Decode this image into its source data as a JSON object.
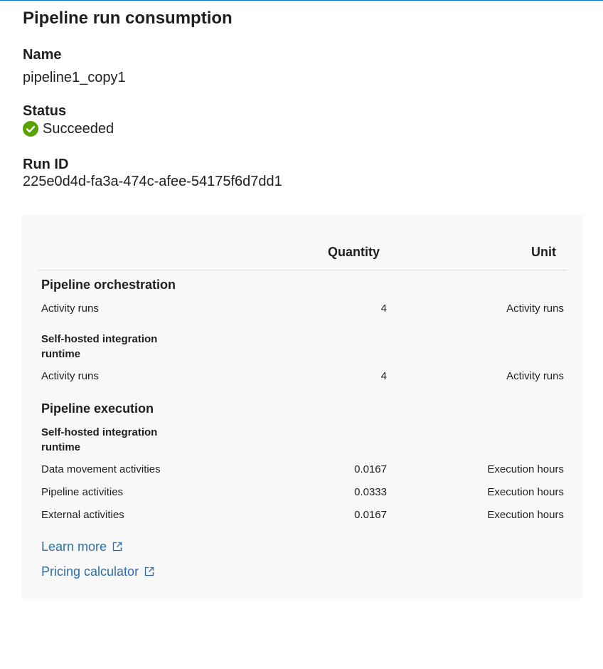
{
  "panel": {
    "title": "Pipeline run consumption"
  },
  "details": {
    "name_label": "Name",
    "name_value": "pipeline1_copy1",
    "status_label": "Status",
    "status_value": "Succeeded",
    "run_id_label": "Run ID",
    "run_id_value": "225e0d4d-fa3a-474c-afee-54175f6d7dd1"
  },
  "table": {
    "headers": {
      "quantity": "Quantity",
      "unit": "Unit"
    },
    "sections": [
      {
        "title": "Pipeline orchestration",
        "groups": [
          {
            "title": "",
            "rows": [
              {
                "label": "Activity runs",
                "quantity": "4",
                "unit": "Activity runs"
              }
            ]
          },
          {
            "title": "Self-hosted integration runtime",
            "rows": [
              {
                "label": "Activity runs",
                "quantity": "4",
                "unit": "Activity runs"
              }
            ]
          }
        ]
      },
      {
        "title": "Pipeline execution",
        "groups": [
          {
            "title": "Self-hosted integration runtime",
            "rows": [
              {
                "label": "Data movement activities",
                "quantity": "0.0167",
                "unit": "Execution hours"
              },
              {
                "label": "Pipeline activities",
                "quantity": "0.0333",
                "unit": "Execution hours"
              },
              {
                "label": "External activities",
                "quantity": "0.0167",
                "unit": "Execution hours"
              }
            ]
          }
        ]
      }
    ]
  },
  "links": {
    "learn_more": "Learn more",
    "pricing_calculator": "Pricing calculator"
  },
  "colors": {
    "accent": "#0078d4",
    "link": "#2e6ca8",
    "success": "#57a300",
    "panel_bg": "#f8f8f8"
  },
  "icons": {
    "status": "check-circle-icon",
    "external": "external-link-icon"
  }
}
